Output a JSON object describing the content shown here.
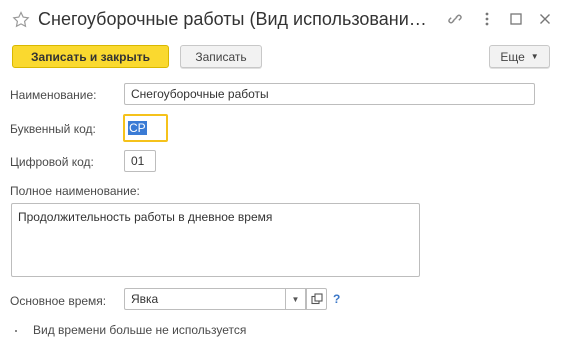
{
  "window": {
    "title": "Снегоуборочные работы (Вид использования рабочего времени)",
    "icons": {
      "favorite": "star-icon",
      "link": "link-icon",
      "more": "more-vertical-icon",
      "maximize": "maximize-icon",
      "close": "close-icon"
    }
  },
  "toolbar": {
    "save_close_label": "Записать и закрыть",
    "save_label": "Записать",
    "more_label": "Еще"
  },
  "form": {
    "name_label": "Наименование:",
    "name_value": "Снегоуборочные работы",
    "letter_code_label": "Буквенный код:",
    "letter_code_value": "СР",
    "digital_code_label": "Цифровой код:",
    "digital_code_value": "01",
    "full_name_label": "Полное наименование:",
    "full_name_value": "Продолжительность работы в дневное время",
    "main_time_label": "Основное время:",
    "main_time_value": "Явка",
    "help_label": "?",
    "unused_label": "Вид времени больше не используется",
    "unused_checked": false
  },
  "colors": {
    "primary_button": "#fad92f",
    "focus_border": "#f5c21b",
    "selection": "#3a7bd5",
    "help": "#3c78c8"
  }
}
